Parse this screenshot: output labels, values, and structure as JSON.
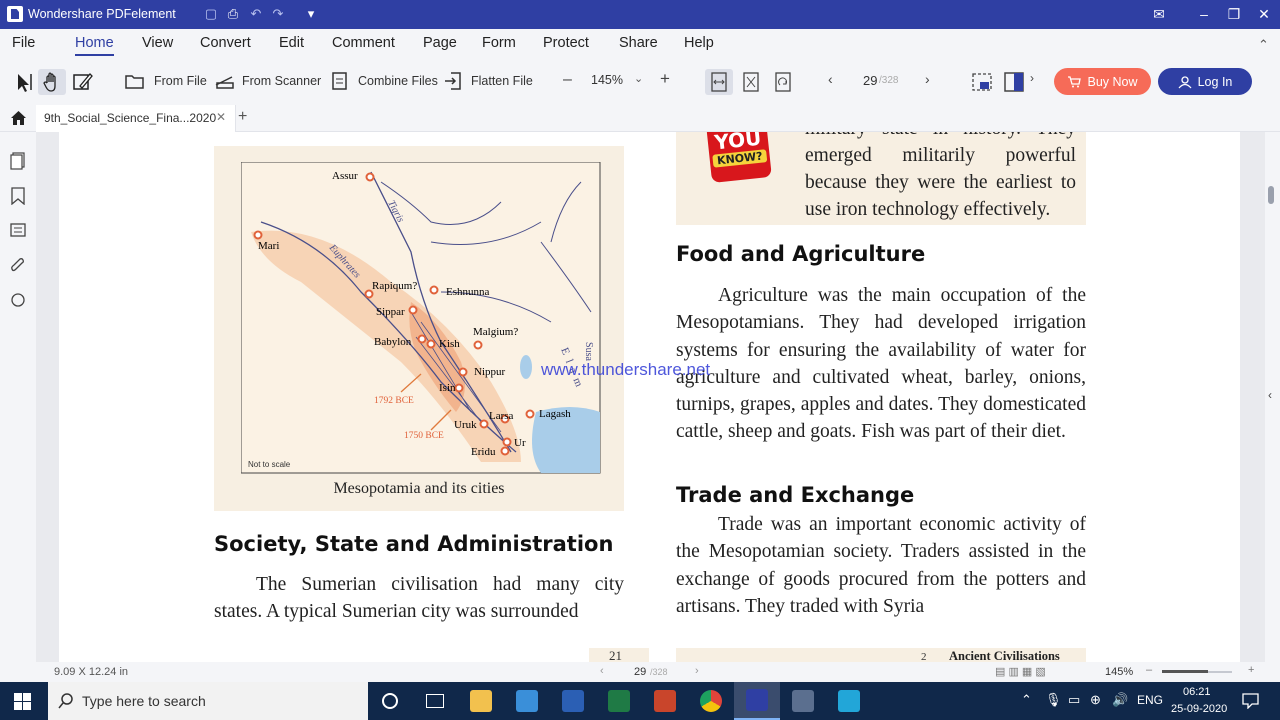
{
  "window": {
    "app_title": "Wondershare PDFelement"
  },
  "menu": [
    "File",
    "Home",
    "View",
    "Convert",
    "Edit",
    "Comment",
    "Page",
    "Form",
    "Protect",
    "Share",
    "Help"
  ],
  "toolbar": {
    "from_file": "From File",
    "from_scanner": "From Scanner",
    "combine_files": "Combine Files",
    "flatten_file": "Flatten File",
    "zoom": "145%",
    "page_current": "29",
    "page_total": "/328",
    "buy_now": "Buy Now",
    "log_in": "Log In"
  },
  "tab": {
    "doc_name": "9th_Social_Science_Fina...2020"
  },
  "document": {
    "map": {
      "caption": "Mesopotamia and its cities",
      "note": "Not to scale",
      "cities": [
        "Assur",
        "Mari",
        "Rapiqum?",
        "Eshnunna",
        "Sippar",
        "Malgium?",
        "Babylon",
        "Kish",
        "Nippur",
        "Isin",
        "Larsa",
        "Lagash",
        "Uruk",
        "Ur",
        "Eridu"
      ],
      "rivers": [
        "Tigris",
        "Euphrates"
      ],
      "region_labels": [
        "Elam",
        "Susa"
      ],
      "dates": [
        "1792 BCE",
        "1750 BCE"
      ]
    },
    "did_you_know": {
      "badge_top": "YOU",
      "badge_bottom": "KNOW?",
      "lines": [
        "military state in history. They",
        "emerged militarily powerful",
        "because they were the earliest to",
        "use iron technology effectively."
      ]
    },
    "food_heading": "Food and Agriculture",
    "food_text": "Agriculture was the main occupation of the Mesopotamians. They had developed irrigation systems for ensuring the availability of water for agriculture and cultivated wheat, barley, onions, turnips, grapes, apples and dates. They domesticated cattle, sheep and goats. Fish was part of their diet.",
    "watermark": "www.thundershare.net",
    "trade_heading": "Trade and Exchange",
    "trade_text": "Trade was an important economic activity of the Mesopotamian society. Traders assisted in the exchange of goods procured from the potters and artisans. They traded with Syria",
    "society_heading": "Society, State and Administration",
    "society_text": "The Sumerian civilisation had many city states. A typical Sumerian city was surrounded",
    "footer_page": "21",
    "footer_chapter": "Ancient Civilisations",
    "footer_num": "2"
  },
  "statusbar": {
    "dimensions": "9.09 X 12.24 in",
    "page_current": "29",
    "page_total": "/328",
    "zoom": "145%"
  },
  "taskbar": {
    "search_placeholder": "Type here to search",
    "language": "ENG",
    "time": "06:21",
    "date": "25-09-2020"
  },
  "colors": {
    "brand": "#2f3fa3",
    "buy": "#f66b58",
    "taskbar": "#10284a"
  }
}
